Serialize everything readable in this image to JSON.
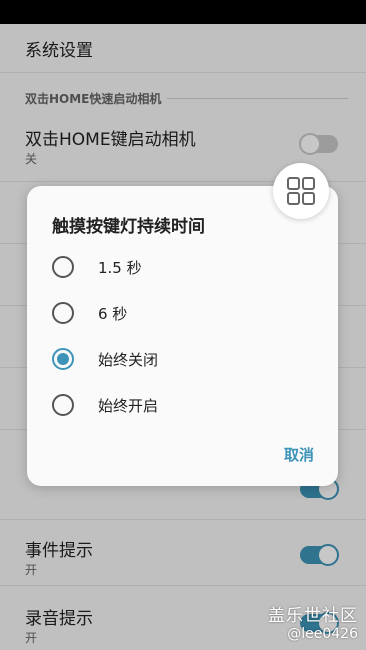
{
  "app": {
    "title": "系统设置"
  },
  "section": {
    "header": "双击HOME快速启动相机"
  },
  "rows": [
    {
      "title": "双击HOME键启动相机",
      "sub": "关",
      "switch": "off"
    },
    {
      "title": "事件提示",
      "sub": "开",
      "switch": "on"
    },
    {
      "title": "录音提示",
      "sub": "开",
      "switch": "on"
    }
  ],
  "dialog": {
    "title": "触摸按键灯持续时间",
    "options": [
      {
        "label": "1.5 秒",
        "checked": false
      },
      {
        "label": "6 秒",
        "checked": false
      },
      {
        "label": "始终关闭",
        "checked": true
      },
      {
        "label": "始终开启",
        "checked": false
      }
    ],
    "cancel_label": "取消"
  },
  "watermark": {
    "line1": "盖乐世社区",
    "line2": "@lee0426"
  },
  "colors": {
    "accent": "#3d94b8"
  }
}
